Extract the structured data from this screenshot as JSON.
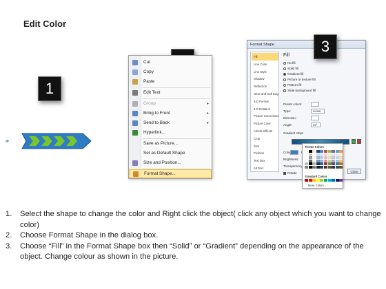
{
  "page": {
    "title": "Edit Color"
  },
  "badges": [
    "1",
    "2",
    "3"
  ],
  "shape": {
    "colors": {
      "fill": "#2e7cc4",
      "chevron": "#7ac52c",
      "outline": "#1a4f8a"
    }
  },
  "context_menu": {
    "items": [
      {
        "label": "Cut",
        "icon": "scissors-icon",
        "enabled": true,
        "submenu": false,
        "highlight": false
      },
      {
        "label": "Copy",
        "icon": "copy-icon",
        "enabled": true,
        "submenu": false,
        "highlight": false
      },
      {
        "label": "Paste",
        "icon": "paste-icon",
        "enabled": true,
        "submenu": false,
        "highlight": false
      },
      {
        "label": "Edit Text",
        "icon": "edit-text-icon",
        "enabled": true,
        "submenu": false,
        "highlight": false
      },
      {
        "label": "Group",
        "icon": "group-icon",
        "enabled": false,
        "submenu": true,
        "highlight": false
      },
      {
        "label": "Bring to Front",
        "icon": "bring-to-front-icon",
        "enabled": true,
        "submenu": true,
        "highlight": false
      },
      {
        "label": "Send to Back",
        "icon": "send-to-back-icon",
        "enabled": true,
        "submenu": true,
        "highlight": false
      },
      {
        "label": "Hyperlink...",
        "icon": "hyperlink-icon",
        "enabled": true,
        "submenu": false,
        "highlight": false
      },
      {
        "label": "Save as Picture...",
        "icon": "",
        "enabled": true,
        "submenu": false,
        "highlight": false
      },
      {
        "label": "Set as Default Shape",
        "icon": "",
        "enabled": true,
        "submenu": false,
        "highlight": false
      },
      {
        "label": "Size and Position...",
        "icon": "size-position-icon",
        "enabled": true,
        "submenu": false,
        "highlight": false
      },
      {
        "label": "Format Shape...",
        "icon": "format-shape-icon",
        "enabled": true,
        "submenu": false,
        "highlight": true
      }
    ]
  },
  "dialog": {
    "title": "Format Shape",
    "categories": [
      "Fill",
      "Line Color",
      "Line Style",
      "Shadow",
      "Reflection",
      "Glow and Soft Edges",
      "3-D Format",
      "3-D Rotation",
      "Picture Corrections",
      "Picture Color",
      "Artistic Effects",
      "Crop",
      "Size",
      "Position",
      "Text Box",
      "Alt Text"
    ],
    "selected_category": "Fill",
    "fill_heading": "Fill",
    "options": [
      {
        "label": "No fill",
        "selected": false
      },
      {
        "label": "Solid fill",
        "selected": false
      },
      {
        "label": "Gradient fill",
        "selected": true
      },
      {
        "label": "Picture or texture fill",
        "selected": false
      },
      {
        "label": "Pattern fill",
        "selected": false
      },
      {
        "label": "Slide background fill",
        "selected": false
      }
    ],
    "fields": {
      "preset_colors": "Preset colors:",
      "type": "Type:",
      "type_value": "Linear",
      "direction": "Direction:",
      "angle": "Angle:",
      "angle_value": "45°",
      "gradient_stops": "Gradient stops",
      "color": "Color",
      "position": "Position:",
      "position_value": "0%",
      "brightness": "Brightness:",
      "transparency": "Transparency:",
      "rotate": "Rotate"
    },
    "close_label": "Close"
  },
  "palette": {
    "theme_label": "Theme Colors",
    "standard_label": "Standard Colors",
    "more_label": "More Colors...",
    "theme_colors": [
      "#ffffff",
      "#000000",
      "#eeece1",
      "#1f497d",
      "#4f81bd",
      "#c0504d",
      "#9bbb59",
      "#8064a2",
      "#4bacc6",
      "#f79646"
    ],
    "standard_colors": [
      "#c00000",
      "#ff0000",
      "#ffc000",
      "#ffff00",
      "#92d050",
      "#00b050",
      "#00b0f0",
      "#0070c0",
      "#002060",
      "#7030a0"
    ]
  },
  "instructions": [
    {
      "num": "1.",
      "text": "Select the shape to change the color and Right click the object( click any object which you want to change color)"
    },
    {
      "num": "2.",
      "text": "Choose Format Shape in the dialog box."
    },
    {
      "num": "3.",
      "text": "Choose “Fill” in the Format Shape box then “Solid” or “Gradient” depending on the appearance of the object. Change colour as shown in the picture."
    }
  ]
}
